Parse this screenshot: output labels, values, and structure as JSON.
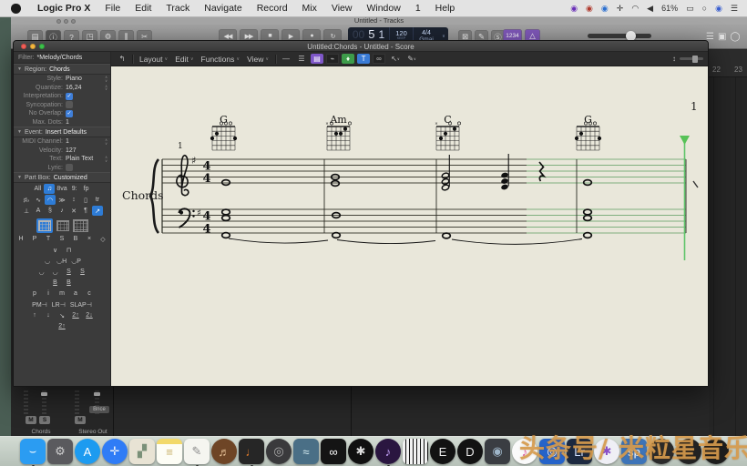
{
  "menubar": {
    "items": [
      {
        "g": "Logic Pro X",
        "bold": 1,
        "name": "menu-logic-pro-x"
      },
      {
        "g": "File",
        "name": "menu-file"
      },
      {
        "g": "Edit",
        "name": "menu-edit"
      },
      {
        "g": "Track",
        "name": "menu-track"
      },
      {
        "g": "Navigate",
        "name": "menu-navigate"
      },
      {
        "g": "Record",
        "name": "menu-record"
      },
      {
        "g": "Mix",
        "name": "menu-mix"
      },
      {
        "g": "View",
        "name": "menu-view"
      },
      {
        "g": "Window",
        "name": "menu-window"
      },
      {
        "g": "1",
        "name": "menu-1"
      },
      {
        "g": "Help",
        "name": "menu-help"
      }
    ],
    "status_icons": [
      {
        "g": "◉",
        "c": "#6a2fb8",
        "name": "status-app-purple-icon"
      },
      {
        "g": "◉",
        "c": "#b03a2e",
        "name": "status-app-red-icon"
      },
      {
        "g": "◉",
        "c": "#2a6fd0",
        "name": "status-eye-icon"
      },
      {
        "g": "✛",
        "c": "#333",
        "name": "status-move-icon"
      },
      {
        "g": "◠",
        "c": "#333",
        "name": "wifi-icon"
      },
      {
        "g": "◀",
        "c": "#333",
        "name": "volume-icon"
      },
      {
        "g": "61%",
        "c": "#333",
        "name": "battery-percentage"
      },
      {
        "g": "▭",
        "c": "#333",
        "name": "battery-icon"
      },
      {
        "g": "○",
        "c": "#333",
        "name": "spotlight-icon"
      },
      {
        "g": "◉",
        "c": "#3a5fd0",
        "name": "siri-icon"
      },
      {
        "g": "☰",
        "c": "#333",
        "name": "notification-center-icon"
      }
    ]
  },
  "main_window": {
    "title": "Untitled - Tracks",
    "left_buttons": [
      {
        "g": "▤",
        "name": "library-button"
      },
      {
        "g": "ⓘ",
        "sel": 1,
        "name": "inspector-button"
      },
      {
        "g": "?",
        "name": "quick-help-button"
      },
      {
        "g": "◳",
        "name": "toolbar-button"
      },
      {
        "g": "⚙",
        "name": "smart-controls-button"
      },
      {
        "g": "⫼",
        "name": "mixer-button"
      },
      {
        "g": "✂",
        "name": "editors-button"
      }
    ],
    "transport": [
      {
        "g": "◀◀",
        "name": "rewind-button"
      },
      {
        "g": "▶▶",
        "name": "forward-button"
      },
      {
        "g": "■",
        "name": "stop-button"
      },
      {
        "g": "▶",
        "name": "play-button"
      },
      {
        "g": "●",
        "rec": 1,
        "name": "record-button"
      },
      {
        "g": "↻",
        "name": "cycle-button"
      }
    ],
    "lcd": {
      "bar_dim": "00",
      "bar": "5",
      "beat": "1",
      "bar_label": "BAR",
      "beat_label": "BEAT",
      "tempo": "120",
      "tempo_label": "KEEP\nTEMPO",
      "sig": "4/4",
      "key": "Gmaj",
      "chevron": "∨"
    },
    "mid_buttons": [
      {
        "g": "⊠",
        "name": "master-mute-button"
      },
      {
        "g": "✎",
        "name": "pencil-mode-button"
      },
      {
        "g": "Ⓢ",
        "name": "solo-mode-button"
      }
    ],
    "count_in_label": "1234",
    "metronome_glyph": "△",
    "right_buttons": [
      {
        "g": "☰",
        "name": "list-editors-button"
      },
      {
        "g": "▣",
        "name": "note-pads-button"
      },
      {
        "g": "◯",
        "name": "apple-loops-button"
      }
    ],
    "ruler_numbers": [
      "22",
      "23"
    ]
  },
  "score_window": {
    "title": "Untitled:Chords - Untitled - Score",
    "hook_glyph": "↰",
    "menus": [
      {
        "g": "Layout",
        "name": "score-menu-layout"
      },
      {
        "g": "Edit",
        "name": "score-menu-edit"
      },
      {
        "g": "Functions",
        "name": "score-menu-functions"
      },
      {
        "g": "View",
        "name": "score-menu-view"
      }
    ],
    "chevron": "∨",
    "view_icons": [
      {
        "g": "—",
        "name": "view-linear-button"
      },
      {
        "g": "☰",
        "name": "view-wrapped-button"
      },
      {
        "g": "▤",
        "sel": "purple",
        "name": "view-page-button"
      },
      {
        "g": "⌁",
        "dark": 1,
        "name": "midi-in-button"
      },
      {
        "g": "♦",
        "sel": "green",
        "name": "midi-out-button"
      },
      {
        "g": "T",
        "sel": "blue",
        "name": "step-input-button"
      },
      {
        "g": "∞",
        "dark": 1,
        "name": "link-button"
      }
    ],
    "pointer_glyph": "↖",
    "pencil_glyph": "✎",
    "resize_glyph": "↕"
  },
  "inspector": {
    "filter_label": "Filter:",
    "filter_value": "*Melody/Chords",
    "region_title": "Region:",
    "region_value": "Chords",
    "region_rows": [
      {
        "label": "Style:",
        "value": "Piano",
        "stepper": "∧\n∨"
      },
      {
        "label": "Quantize:",
        "value": "16,24",
        "stepper": "∧\n∨"
      },
      {
        "label": "Interpretation:",
        "check": "on"
      },
      {
        "label": "Syncopation:",
        "check": "off"
      },
      {
        "label": "No Overlap:",
        "check": "on"
      },
      {
        "label": "Max. Dots:",
        "value": "1"
      }
    ],
    "event_title": "Event:",
    "event_value": "Insert Defaults",
    "event_rows": [
      {
        "label": "MIDI Channel:",
        "value": "1",
        "stepper": "∧\n∨"
      },
      {
        "label": "Velocity:",
        "value": "127"
      },
      {
        "label": "Text:",
        "value": "Plain Text",
        "stepper": "∧\n∨"
      },
      {
        "label": "Lyric:",
        "check": "off"
      }
    ],
    "partbox_title": "Part Box:",
    "partbox_value": "Customized",
    "partbox_rows": [
      {
        "cells": [
          {
            "g": "All"
          },
          {
            "g": "♫",
            "sel": 1
          },
          {
            "g": "8va"
          },
          {
            "g": "9:"
          },
          {
            "g": "fp"
          }
        ]
      },
      {
        "cells": [
          {
            "g": "♯♭"
          },
          {
            "g": "∿"
          },
          {
            "g": "◠",
            "sel": 1
          },
          {
            "g": "≫"
          },
          {
            "g": "↕"
          },
          {
            "g": "▯"
          },
          {
            "g": "tr"
          }
        ]
      },
      {
        "cells": [
          {
            "g": "⊥"
          },
          {
            "g": "A"
          },
          {
            "g": "§"
          },
          {
            "g": "♪"
          },
          {
            "g": "✕"
          },
          {
            "g": "¶"
          },
          {
            "g": "↗",
            "sel": 1
          }
        ]
      }
    ],
    "tab_rows": [
      {
        "cells": [
          {
            "g": "H"
          },
          {
            "g": "P"
          },
          {
            "g": "T"
          },
          {
            "g": "S"
          },
          {
            "g": "B"
          },
          {
            "g": "×"
          },
          {
            "g": "◇"
          }
        ]
      },
      {
        "cells": [
          {
            "g": "∨"
          },
          {
            "g": "⊓"
          }
        ]
      },
      {
        "cells": [
          {
            "g": "◡"
          },
          {
            "g": "◡H"
          },
          {
            "g": "◡P"
          }
        ]
      },
      {
        "cells": [
          {
            "g": "◡"
          },
          {
            "g": "◡"
          },
          {
            "g": "S",
            "u": 1
          },
          {
            "g": "S",
            "u": 1
          }
        ]
      },
      {
        "cells": [
          {
            "g": "B",
            "u": 1
          },
          {
            "g": "B",
            "u": 1
          }
        ]
      },
      {
        "cells": [
          {
            "g": "p"
          },
          {
            "g": "i"
          },
          {
            "g": "m"
          },
          {
            "g": "a"
          },
          {
            "g": "c"
          }
        ]
      },
      {
        "cells": [
          {
            "g": "PM⊣"
          },
          {
            "g": "LR⊣"
          },
          {
            "g": "SLAP⊣"
          }
        ]
      },
      {
        "cells": [
          {
            "g": "↑"
          },
          {
            "g": "↓"
          },
          {
            "g": "↘"
          },
          {
            "g": "2↑",
            "u": 1
          },
          {
            "g": "2↓",
            "u": 1
          }
        ]
      },
      {
        "cells": [
          {
            "g": "2↑",
            "u": 1
          }
        ]
      }
    ]
  },
  "score": {
    "track_name": "Chords",
    "measure_number": "1",
    "page_number": "1",
    "key_signature": "♯",
    "time_sig_top": "4",
    "time_sig_bottom": "4",
    "chords": [
      {
        "name": "G",
        "frets": [
          3,
          2,
          0,
          0,
          0,
          3
        ]
      },
      {
        "name": "Am",
        "frets": [
          -1,
          0,
          2,
          2,
          1,
          0
        ]
      },
      {
        "name": "C",
        "frets": [
          -1,
          3,
          2,
          0,
          1,
          0
        ]
      },
      {
        "name": "G",
        "frets": [
          3,
          2,
          0,
          0,
          0,
          3
        ]
      }
    ]
  },
  "mixer": {
    "strip1_name": "Chords",
    "strip1_mute": "M",
    "strip1_solo": "S",
    "strip2_name": "Stereo Out",
    "strip2_mute": "M",
    "strip2_bounce": "Bnce"
  },
  "dock": [
    {
      "name": "dock-finder-icon",
      "bg": "#2b9cf2",
      "g": "⌣",
      "c": "#fff",
      "running": 1
    },
    {
      "name": "dock-system-preferences-icon",
      "bg": "#5a5a5e",
      "g": "⚙",
      "c": "#cfcfcf"
    },
    {
      "name": "dock-app-store-icon",
      "bg": "#1d9bf0",
      "g": "A",
      "c": "#fff",
      "round": 1
    },
    {
      "name": "dock-safari-icon",
      "bg": "#2f7cf6",
      "g": "✛",
      "c": "#f2f4f8",
      "round": 1
    },
    {
      "name": "dock-preview-icon",
      "bg": "#e8e3d4",
      "g": "▞",
      "c": "#7a9078"
    },
    {
      "name": "dock-notes-icon",
      "bg": "linear-gradient(#f2d96a 0 22%, #fdfdf5 22%)",
      "g": "≡",
      "c": "#c9b26a"
    },
    {
      "name": "dock-textedit-icon",
      "bg": "#f5f5f0",
      "g": "✎",
      "c": "#8a8a8a",
      "running": 1
    },
    {
      "name": "dock-garageband-icon",
      "bg": "#6e4526",
      "g": "♬",
      "c": "#e8c49a",
      "round": 1
    },
    {
      "name": "dock-performer-app-icon",
      "bg": "#262626",
      "g": "♩",
      "c": "#e07b2a",
      "running": 1
    },
    {
      "name": "dock-disk-app-icon",
      "bg": "#3a3a3c",
      "g": "◎",
      "c": "#ababab",
      "round": 1
    },
    {
      "name": "dock-music-learning-app-icon",
      "bg": "#4a6f86",
      "g": "≈",
      "c": "#d8eef2"
    },
    {
      "name": "dock-dolby-app-icon",
      "bg": "#141414",
      "g": "∞",
      "c": "#fff"
    },
    {
      "name": "dock-obs-icon",
      "bg": "#101010",
      "g": "✱",
      "c": "#dcdcdc",
      "round": 1
    },
    {
      "name": "dock-notation-app-icon",
      "bg": "#2a1640",
      "g": "♪",
      "c": "#c9a6ff",
      "round": 1,
      "running": 1
    },
    {
      "name": "dock-piano-app-icon",
      "bg": "#1a1a1a",
      "g": "",
      "keys": 1
    },
    {
      "name": "dock-e-app-icon",
      "bg": "#121212",
      "g": "E",
      "c": "#ededed",
      "round": 1
    },
    {
      "name": "dock-d-app-icon",
      "bg": "#121212",
      "g": "D",
      "c": "#ededed",
      "round": 1
    },
    {
      "name": "dock-camera-app-icon",
      "bg": "#3a3d42",
      "g": "◉",
      "c": "#9fb6c9"
    },
    {
      "name": "dock-itunes-icon",
      "bg": "#fafafa",
      "g": "♪",
      "c": "#e0559c",
      "round": 1
    },
    {
      "name": "dock-logic-remote-icon",
      "bg": "#2563c9",
      "g": "◎",
      "c": "#fff"
    },
    {
      "name": "dock-lightroom-icon",
      "bg": "#1c2940",
      "g": "Lr",
      "c": "#cfe0ff"
    },
    {
      "name": "dock-media-player-icon",
      "bg": "#efeff5",
      "g": "✱",
      "c": "#8a4fc8",
      "round": 1
    },
    {
      "name": "dock-sp-app-icon",
      "bg": "#3d74b8",
      "g": "sp",
      "c": "#fff"
    },
    {
      "name": "dock-hidden-app-1",
      "bg": "#2a2a2a",
      "g": "",
      "round": 1
    },
    {
      "name": "dock-hidden-app-2",
      "bg": "#222222",
      "g": "",
      "round": 1
    },
    {
      "name": "dock-hidden-app-3",
      "bg": "#1d1d1d",
      "g": "",
      "round": 1
    }
  ],
  "watermark": "头条号/ 米粒星音乐",
  "colors": {
    "accent_purple": "#7e57c8",
    "accent_green": "#3d9c4a",
    "accent_blue": "#3a7bd5",
    "playhead_green": "#5fc46a",
    "paper": "#e9e7da"
  }
}
